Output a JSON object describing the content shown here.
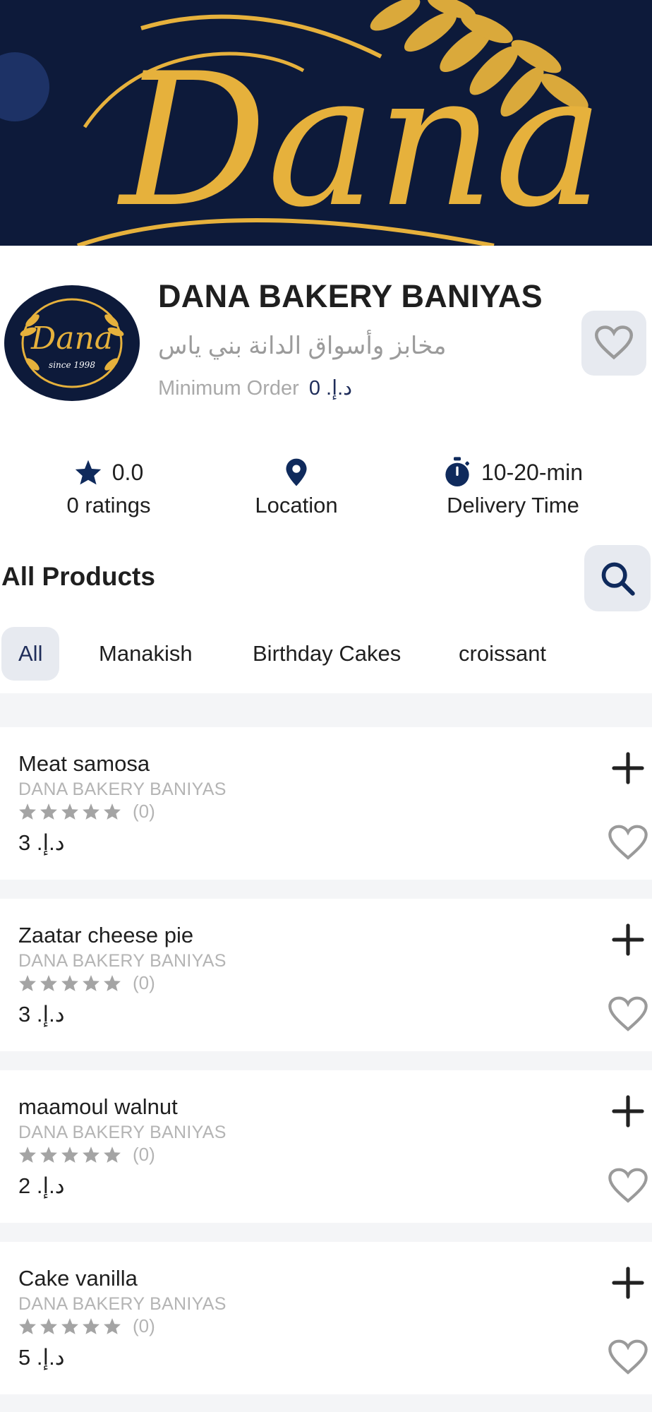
{
  "header": {
    "back_icon": "chevron-left-icon",
    "banner_text": "Dana"
  },
  "store": {
    "name": "DANA BAKERY BANIYAS",
    "name_ar": "مخابز وأسواق الدانة  بني ياس",
    "min_order_label": "Minimum Order",
    "min_order_value": "د.إ. 0",
    "logo_text": "Dana",
    "logo_since": "since 1998",
    "favorite_icon": "heart-outline-icon"
  },
  "stats": {
    "rating": {
      "icon": "star-icon",
      "value": "0.0",
      "label": "0 ratings"
    },
    "location": {
      "icon": "location-pin-icon",
      "label": "Location"
    },
    "delivery": {
      "icon": "stopwatch-icon",
      "value": "10-20-min",
      "label": "Delivery Time"
    }
  },
  "products": {
    "title": "All Products",
    "search_icon": "search-icon",
    "tabs": [
      "All",
      "Manakish",
      "Birthday Cakes",
      "croissant"
    ],
    "active_tab": "All",
    "items": [
      {
        "name": "Meat samosa",
        "shop": "DANA BAKERY BANIYAS",
        "rating_count": "(0)",
        "price": "د.إ. 3"
      },
      {
        "name": "Zaatar cheese pie",
        "shop": "DANA BAKERY BANIYAS",
        "rating_count": "(0)",
        "price": "د.إ. 3"
      },
      {
        "name": "maamoul walnut",
        "shop": "DANA BAKERY BANIYAS",
        "rating_count": "(0)",
        "price": "د.إ. 2"
      },
      {
        "name": "Cake vanilla",
        "shop": "DANA BAKERY BANIYAS",
        "rating_count": "(0)",
        "price": "د.إ. 5"
      }
    ]
  },
  "colors": {
    "navy": "#0d1a3a",
    "accent": "#1f2d5a",
    "gold": "#e6b13c",
    "chip_bg": "#e7eaf0",
    "muted": "#b4b4b4"
  }
}
